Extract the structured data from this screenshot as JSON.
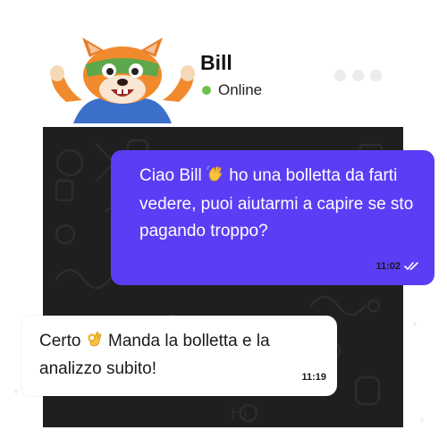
{
  "header": {
    "name": "Bill",
    "status": "Online",
    "status_color": "#6cc24a"
  },
  "messages": [
    {
      "direction": "outgoing",
      "text_before": "Ciao Bill",
      "emoji_icon": "waving-hand-icon",
      "text_after": " ho una bolletta da farti vedere, puoi aiutarmi a capire se sto pagando troppo?",
      "time": "11:02",
      "ticks": "double-check-icon"
    },
    {
      "direction": "incoming",
      "text_before": "Certo",
      "emoji_icon": "ok-hand-icon",
      "text_after": " Manda la bolletta e la analizzo subito!",
      "time": "11:19"
    }
  ],
  "colors": {
    "outgoing_bubble": "#5b3df5",
    "incoming_bubble": "#ffffff",
    "chat_background": "#1f1f1f"
  }
}
